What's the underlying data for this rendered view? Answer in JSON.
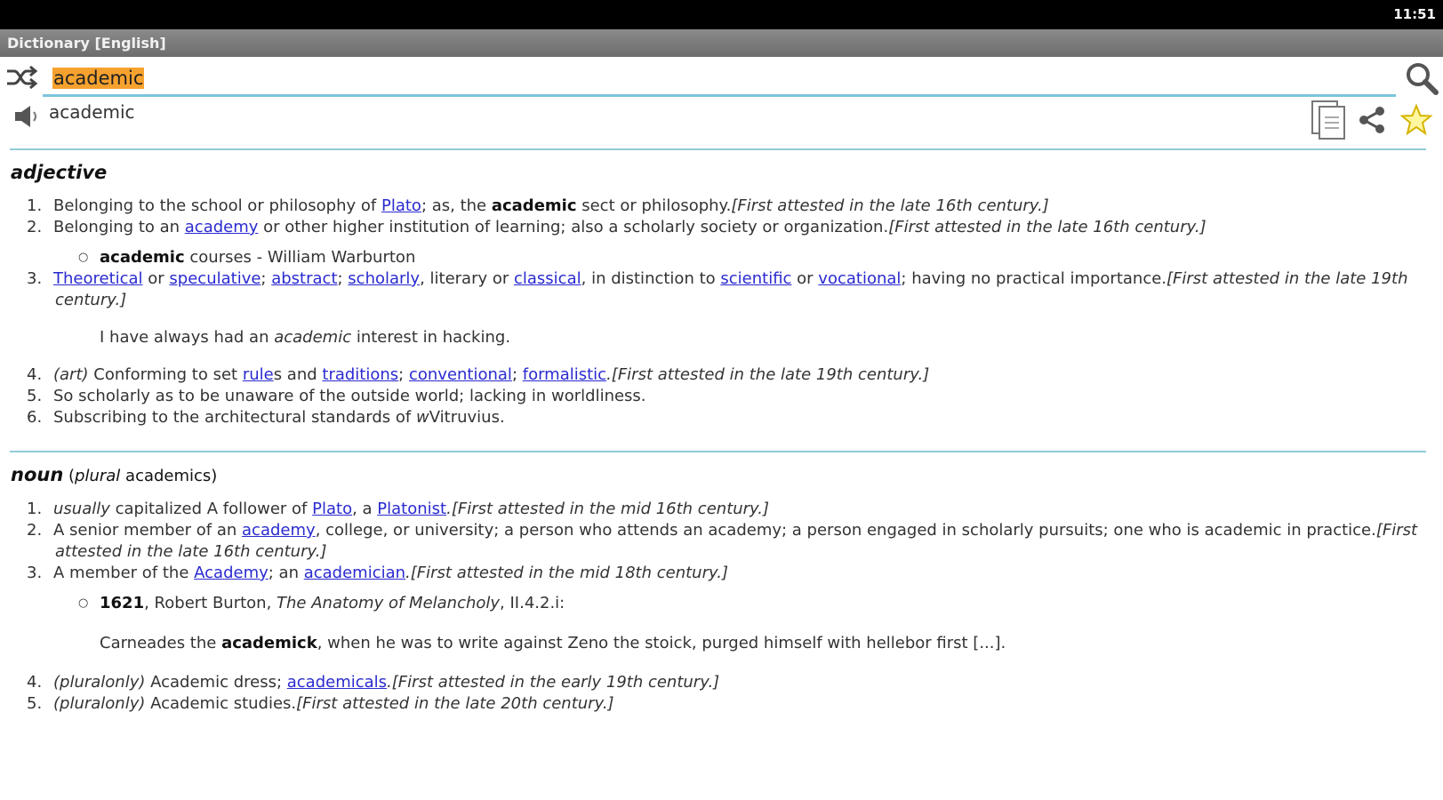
{
  "status": {
    "time": "11:51"
  },
  "app": {
    "title": "Dictionary [English]"
  },
  "search": {
    "value": "academic"
  },
  "entry": {
    "headword": "academic"
  },
  "adjective": {
    "label": "adjective",
    "senses": [
      {
        "num": "1.",
        "text": "Belonging to the school or philosophy of ",
        "link": "Plato",
        "text2": "; as, the ",
        "bold": "academic",
        "text3": " sect or philosophy.",
        "attest": "[First attested in the late 16th century.]"
      },
      {
        "num": "2.",
        "text": "Belonging to an ",
        "link": "academy",
        "text2": " or other higher institution of learning; also a scholarly society or organization.",
        "attest": "[First attested in the late 16th century.]"
      },
      {
        "num": "3.",
        "link1": "Theoretical",
        "or1": " or ",
        "link2": "speculative",
        "sep1": "; ",
        "link3": "abstract",
        "sep2": "; ",
        "link4": "scholarly",
        "text": ", literary or ",
        "link5": "classical",
        "text2": ", in distinction to ",
        "link6": "scientific",
        "or2": " or ",
        "link7": "vocational",
        "text3": "; having no practical importance.",
        "attest": "[First attested in the late 19th",
        "attest2": "century.]"
      },
      {
        "num": "4.",
        "label": "(art)",
        "text": " Conforming to set ",
        "link1": "rule",
        "s": "s and ",
        "link2": "traditions",
        "sep1": "; ",
        "link3": "conventional",
        "sep2": "; ",
        "link4": "formalistic",
        "attest": ".[First attested in the late 19th century.]"
      },
      {
        "num": "5.",
        "text": "So scholarly as to be unaware of the outside world; lacking in worldliness."
      },
      {
        "num": "6.",
        "text": "Subscribing to the architectural standards of ",
        "w": "w",
        "text2": "Vitruvius."
      }
    ],
    "bullet": {
      "bold": "academic",
      "text": " courses - William Warburton"
    },
    "example": {
      "text1": "I have always had an ",
      "em": "academic",
      "text2": " interest in hacking."
    }
  },
  "noun": {
    "label": "noun",
    "plural_open": " (",
    "plural_label": "plural",
    "plural_word": " academics)",
    "senses": [
      {
        "num": "1.",
        "label": "usually",
        "text": " capitalized A follower of ",
        "link1": "Plato",
        "sep": ", a ",
        "link2": "Platonist",
        "attest": ".[First attested in the mid 16th century.]"
      },
      {
        "num": "2.",
        "text": "A senior member of an ",
        "link": "academy",
        "text2": ", college, or university; a person who attends an academy; a person engaged in scholarly pursuits; one who is academic in practice.",
        "attest": "[First",
        "attest2": "attested in the late 16th century.]"
      },
      {
        "num": "3.",
        "text": "A member of the ",
        "link1": "Academy",
        "sep": "; an ",
        "link2": "academician",
        "attest": ".[First attested in the mid 18th century.]"
      },
      {
        "num": "4.",
        "label": "(pluralonly)",
        "text": " Academic dress; ",
        "link": "academicals",
        "attest": ".[First attested in the early 19th century.]"
      },
      {
        "num": "5.",
        "label": "(pluralonly)",
        "text": " Academic studies.",
        "attest": "[First attested in the late 20th century.]"
      }
    ],
    "citation": {
      "year": "1621",
      "text1": ", Robert Burton, ",
      "work": "The Anatomy of Melancholy",
      "text2": ", II.4.2.i:"
    },
    "quote": {
      "text1": "Carneades the ",
      "bold": "academick",
      "text2": ", when he was to write against Zeno the stoick, purged himself with hellebor first [...]."
    }
  }
}
